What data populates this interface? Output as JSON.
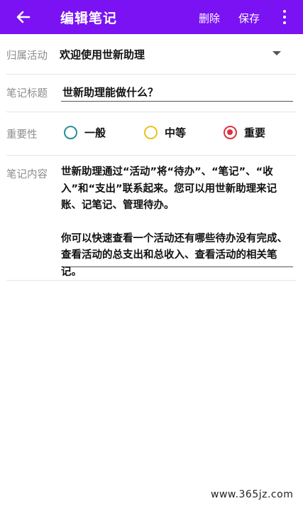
{
  "appbar": {
    "title": "编辑笔记",
    "delete_label": "删除",
    "save_label": "保存",
    "back_icon": "arrow-left-icon",
    "more_icon": "more-vert-icon",
    "color": "#7a12f3"
  },
  "form": {
    "activity": {
      "label": "归属活动",
      "value": "欢迎使用世新助理"
    },
    "title": {
      "label": "笔记标题",
      "value": "世新助理能做什么？"
    },
    "importance": {
      "label": "重要性",
      "options": [
        {
          "label": "一般",
          "color": "#2c8c99",
          "selected": false
        },
        {
          "label": "中等",
          "color": "#e6c41f",
          "selected": false
        },
        {
          "label": "重要",
          "color": "#d9333f",
          "selected": true
        }
      ]
    },
    "content": {
      "label": "笔记内容",
      "paragraph1": "世新助理通过“活动”将“待办”、“笔记”、“收入”和“支出”联系起来。您可以用世新助理来记账、记笔记、管理待办。",
      "paragraph2": "你可以快速查看一个活动还有哪些待办没有完成、查看活动的总支出和总收入、查看活动的相关笔记。"
    }
  },
  "watermark": "www.365jz.com"
}
